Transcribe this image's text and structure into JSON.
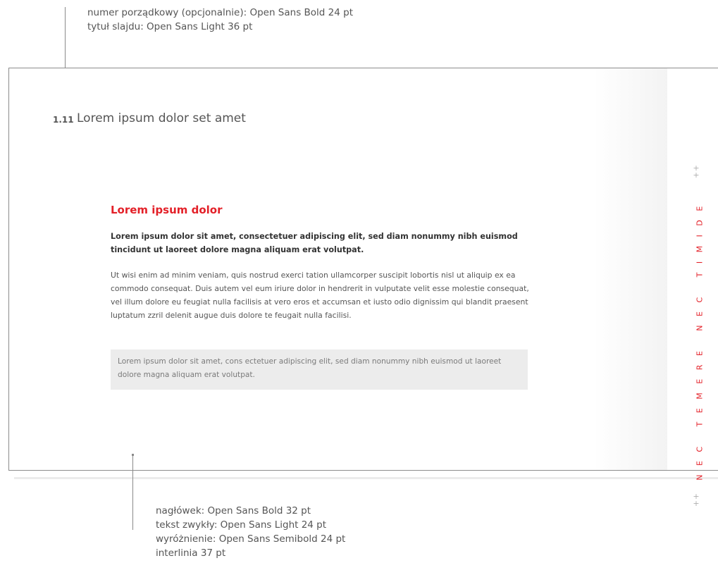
{
  "annotations": {
    "top": [
      "numer porządkowy (opcjonalnie): Open Sans Bold 24 pt",
      "tytuł slajdu: Open Sans Light 36 pt"
    ],
    "bottom": [
      "nagłówek: Open Sans Bold 32 pt",
      "tekst zwykły: Open Sans Light 24 pt",
      "wyróżnienie: Open Sans Semibold 24 pt",
      "interlinia 37 pt"
    ]
  },
  "slide": {
    "number": "1.11",
    "title": "Lorem ipsum dolor set amet",
    "heading": "Lorem ipsum dolor",
    "lead": "Lorem ipsum dolor sit amet, consectetuer adipiscing elit, sed diam nonummy nibh euismod tincidunt ut laoreet dolore magna aliquam erat volutpat.",
    "body": "Ut wisi enim ad minim veniam, quis nostrud exerci tation ullamcorper suscipit lobortis nisl ut aliquip ex ea commodo consequat. Duis autem vel eum iriure dolor in hendrerit in vulputate velit esse molestie consequat, vel illum dolore eu feugiat nulla facilisis at vero eros et accumsan et iusto odio dignissim qui blandit praesent luptatum zzril delenit augue duis dolore te feugait nulla facilisi.",
    "highlight": "Lorem ipsum dolor sit amet, cons ectetuer adipiscing elit, sed diam nonummy nibh euismod ut laoreet dolore magna aliquam erat volutpat.",
    "side_text": "NEC TEMERE NEC TIMIDE",
    "ornament_top": "+\n+",
    "ornament_bottom": "+\n+"
  },
  "colors": {
    "accent": "#e32028",
    "text": "#555555",
    "highlight_bg": "#ececec",
    "frame": "#8c8c8c"
  }
}
